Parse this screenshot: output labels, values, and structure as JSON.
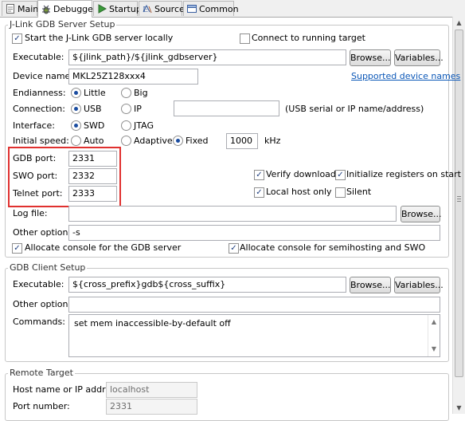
{
  "tabs": [
    {
      "label": "Main",
      "icon": "main-tab-icon"
    },
    {
      "label": "Debugger",
      "icon": "debugger-bug-icon"
    },
    {
      "label": "Startup",
      "icon": "startup-arrow-icon"
    },
    {
      "label": "Source",
      "icon": "source-icon"
    },
    {
      "label": "Common",
      "icon": "common-icon"
    }
  ],
  "server": {
    "title": "J-Link GDB Server Setup",
    "start_locally": "Start the J-Link GDB server locally",
    "connect_running": "Connect to running target",
    "executable_label": "Executable:",
    "executable_value": "${jlink_path}/${jlink_gdbserver}",
    "browse": "Browse...",
    "variables": "Variables...",
    "device_label": "Device name:",
    "device_value": "MKL25Z128xxx4",
    "supported_link": "Supported device names",
    "endianness_label": "Endianness:",
    "little": "Little",
    "big": "Big",
    "connection_label": "Connection:",
    "usb": "USB",
    "ip": "IP",
    "ip_value": "",
    "usb_hint": "(USB serial or IP name/address)",
    "interface_label": "Interface:",
    "swd": "SWD",
    "jtag": "JTAG",
    "speed_label": "Initial speed:",
    "auto": "Auto",
    "adaptive": "Adaptive",
    "fixed": "Fixed",
    "speed_value": "1000",
    "khz": "kHz",
    "gdb_port_label": "GDB port:",
    "gdb_port_value": "2331",
    "swo_port_label": "SWO port:",
    "swo_port_value": "2332",
    "telnet_port_label": "Telnet port:",
    "telnet_port_value": "2333",
    "verify_downloads": "Verify downloads",
    "init_registers": "Initialize registers on start",
    "local_host_only": "Local host only",
    "silent": "Silent",
    "log_label": "Log file:",
    "log_value": "",
    "other_label": "Other options:",
    "other_value": "-s",
    "alloc_gdb": "Allocate console for the GDB server",
    "alloc_semihost": "Allocate console for semihosting and SWO"
  },
  "client": {
    "title": "GDB Client Setup",
    "executable_label": "Executable:",
    "executable_value": "${cross_prefix}gdb${cross_suffix}",
    "browse": "Browse...",
    "variables": "Variables...",
    "other_label": "Other options:",
    "other_value": "",
    "commands_label": "Commands:",
    "commands_value": "set mem inaccessible-by-default off"
  },
  "remote": {
    "title": "Remote Target",
    "host_label": "Host name or IP address:",
    "host_value": "localhost",
    "port_label": "Port number:",
    "port_value": "2331"
  },
  "colors": {
    "highlight": "#e0312f",
    "link": "#0b57b7",
    "checkmark": "#1f3f7f"
  }
}
